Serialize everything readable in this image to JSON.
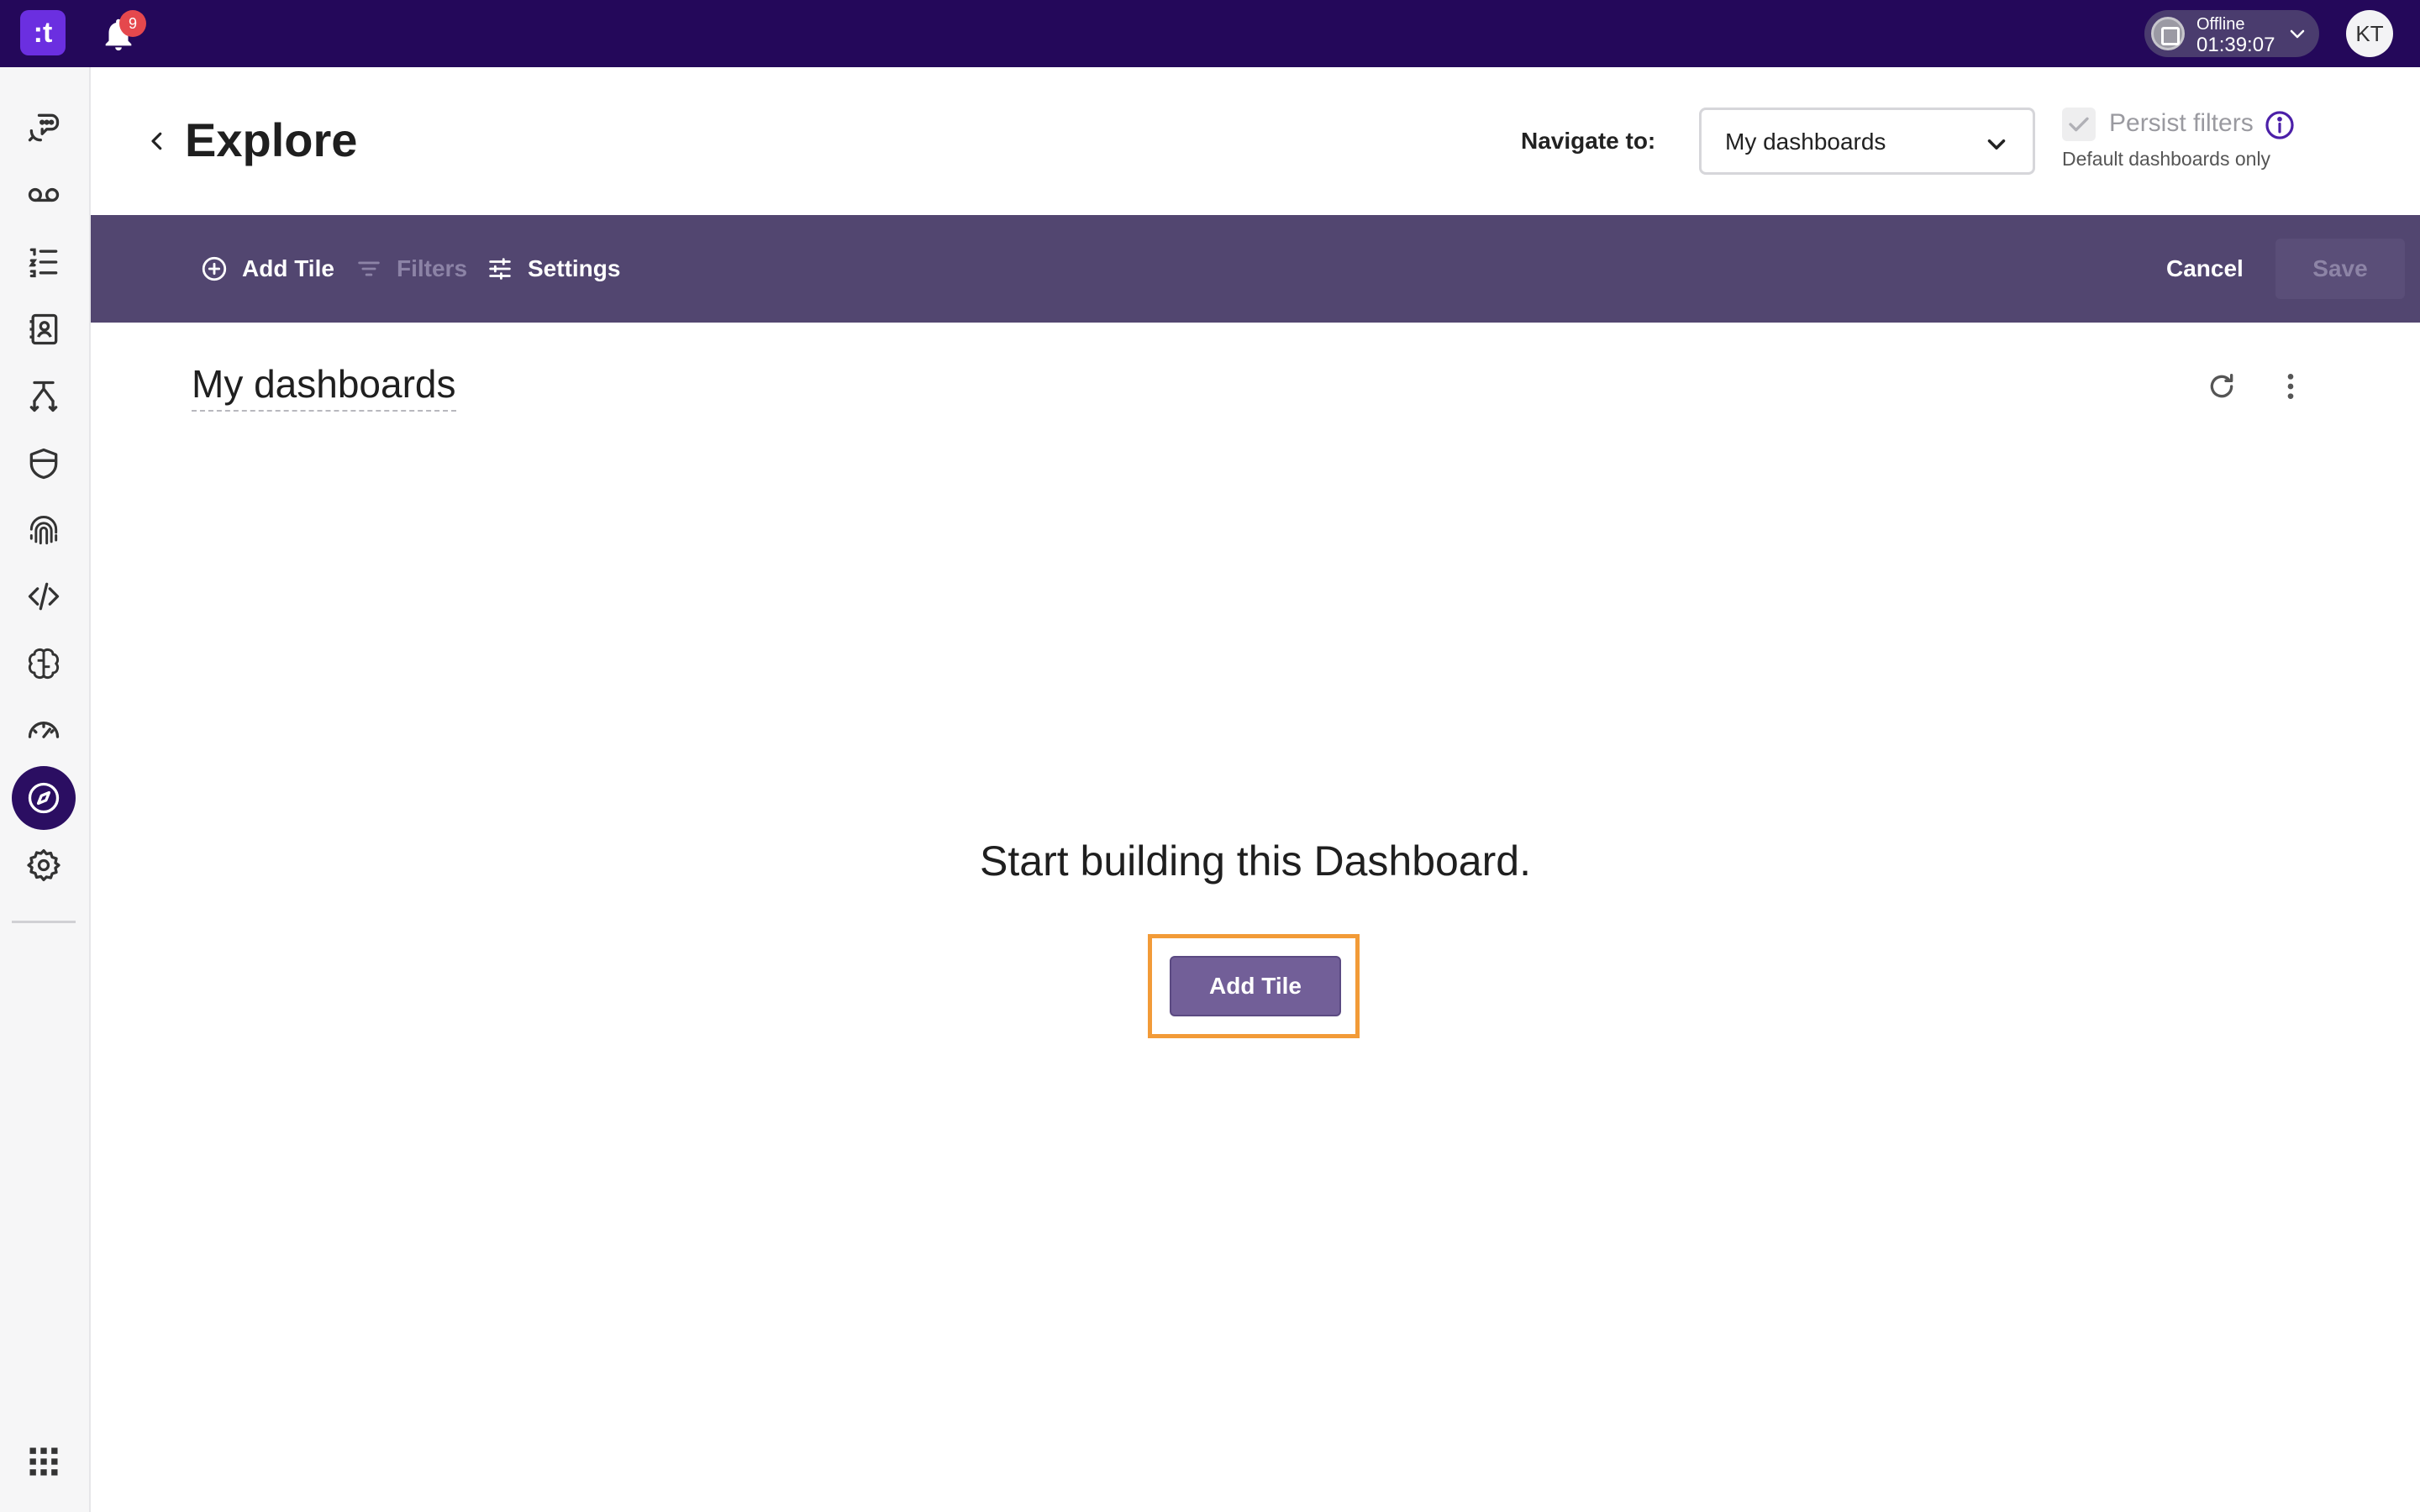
{
  "topbar": {
    "logo_text": ":t",
    "notifications_count": "9",
    "status": {
      "label": "Offline",
      "time": "01:39:07"
    },
    "avatar_initials": "KT"
  },
  "sidebar": {
    "items": [
      {
        "icon": "conversation-icon",
        "active": false
      },
      {
        "icon": "voicemail-icon",
        "active": false
      },
      {
        "icon": "list-icon",
        "active": false
      },
      {
        "icon": "contacts-icon",
        "active": false
      },
      {
        "icon": "routing-icon",
        "active": false
      },
      {
        "icon": "shield-icon",
        "active": false
      },
      {
        "icon": "fingerprint-icon",
        "active": false
      },
      {
        "icon": "code-icon",
        "active": false
      },
      {
        "icon": "brain-icon",
        "active": false
      },
      {
        "icon": "gauge-icon",
        "active": false
      },
      {
        "icon": "compass-icon",
        "active": true
      },
      {
        "icon": "gear-icon",
        "active": false
      }
    ],
    "bottom_icon": "apps-grid-icon"
  },
  "header": {
    "title": "Explore",
    "navigate_label": "Navigate to:",
    "navigate_value": "My dashboards",
    "persist_filters_label": "Persist filters",
    "persist_filters_sub": "Default dashboards only"
  },
  "toolbar": {
    "add_tile_label": "Add Tile",
    "filters_label": "Filters",
    "settings_label": "Settings",
    "cancel_label": "Cancel",
    "save_label": "Save"
  },
  "dashboard": {
    "title": "My dashboards",
    "empty_message": "Start building this Dashboard.",
    "add_tile_button": "Add Tile"
  },
  "colors": {
    "topbar": "#24085a",
    "toolbar": "#524670",
    "accent": "#725f98",
    "highlight": "#f29b38",
    "badge": "#e5484d"
  }
}
